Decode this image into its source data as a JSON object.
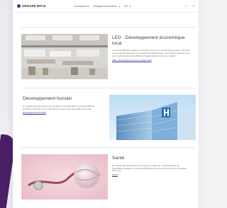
{
  "brand": {
    "name": "GROUPE BPCE"
  },
  "topbar": {
    "nav": [
      "Investisseurs",
      "Obligations durables"
    ],
    "nav_more": "FR"
  },
  "sections": [
    {
      "title": "LED - Développement économique local",
      "body": "Le Groupe BPCE contribue au soutien des tissus économiques locaux, dont des zones économiquement ou socialement défavorisées. Ces actions interviennent par le refinancement de PME et d’organisations à but non lucratif.",
      "link": "SEE - Développement économique local",
      "image": "office-photo"
    },
    {
      "title": "Développement humain",
      "body": "En refinançant des acteurs de la santé et de l’éducation, le Groupe BPCE contribue à l’accès à une éducation et à des soins de qualité pour tous.",
      "link": "Développement humain",
      "image": "hospital-photo"
    },
    {
      "title": "Santé",
      "body": "En refinançant des acteurs de la santé investis au renouvellement de partenaires français, le Groupe BPCE favorise l’accès à des soins de qualité pour tous.",
      "link": "Santé",
      "image": "stethoscope-photo"
    }
  ]
}
